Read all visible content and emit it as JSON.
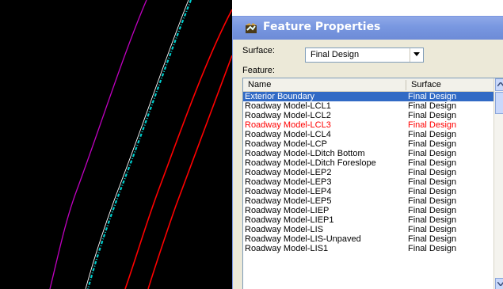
{
  "dialog": {
    "title": "Feature Properties",
    "surface_label": "Surface:",
    "surface_value": "Final Design",
    "feature_label": "Feature:"
  },
  "table": {
    "columns": [
      "Name",
      "Surface"
    ],
    "rows": [
      {
        "name": "Exterior Boundary",
        "surface": "Final Design",
        "state": "selected"
      },
      {
        "name": "Roadway Model-LCL1",
        "surface": "Final Design",
        "state": "normal"
      },
      {
        "name": "Roadway Model-LCL2",
        "surface": "Final Design",
        "state": "normal"
      },
      {
        "name": "Roadway Model-LCL3",
        "surface": "Final Design",
        "state": "red"
      },
      {
        "name": "Roadway Model-LCL4",
        "surface": "Final Design",
        "state": "normal"
      },
      {
        "name": "Roadway Model-LCP",
        "surface": "Final Design",
        "state": "normal"
      },
      {
        "name": "Roadway Model-LDitch Bottom",
        "surface": "Final Design",
        "state": "normal"
      },
      {
        "name": "Roadway Model-LDitch Foreslope",
        "surface": "Final Design",
        "state": "normal"
      },
      {
        "name": "Roadway Model-LEP2",
        "surface": "Final Design",
        "state": "normal"
      },
      {
        "name": "Roadway Model-LEP3",
        "surface": "Final Design",
        "state": "normal"
      },
      {
        "name": "Roadway Model-LEP4",
        "surface": "Final Design",
        "state": "normal"
      },
      {
        "name": "Roadway Model-LEP5",
        "surface": "Final Design",
        "state": "normal"
      },
      {
        "name": "Roadway Model-LIEP",
        "surface": "Final Design",
        "state": "normal"
      },
      {
        "name": "Roadway Model-LIEP1",
        "surface": "Final Design",
        "state": "normal"
      },
      {
        "name": "Roadway Model-LIS",
        "surface": "Final Design",
        "state": "normal"
      },
      {
        "name": "Roadway Model-LIS-Unpaved",
        "surface": "Final Design",
        "state": "normal"
      },
      {
        "name": "Roadway Model-LIS1",
        "surface": "Final Design",
        "state": "normal"
      }
    ]
  },
  "icons": {
    "title": "feature-properties-icon",
    "dropdown": "dropdown-arrow-icon",
    "scroll_up": "scroll-up-icon",
    "scroll_down": "scroll-down-icon"
  },
  "colors": {
    "canvas": "#000000",
    "magenta_line": "#c000c0",
    "cyan_line": "#00cccc",
    "red_line": "#ff0000",
    "selection": "#316ac5",
    "highlight_text": "#ff0000"
  }
}
